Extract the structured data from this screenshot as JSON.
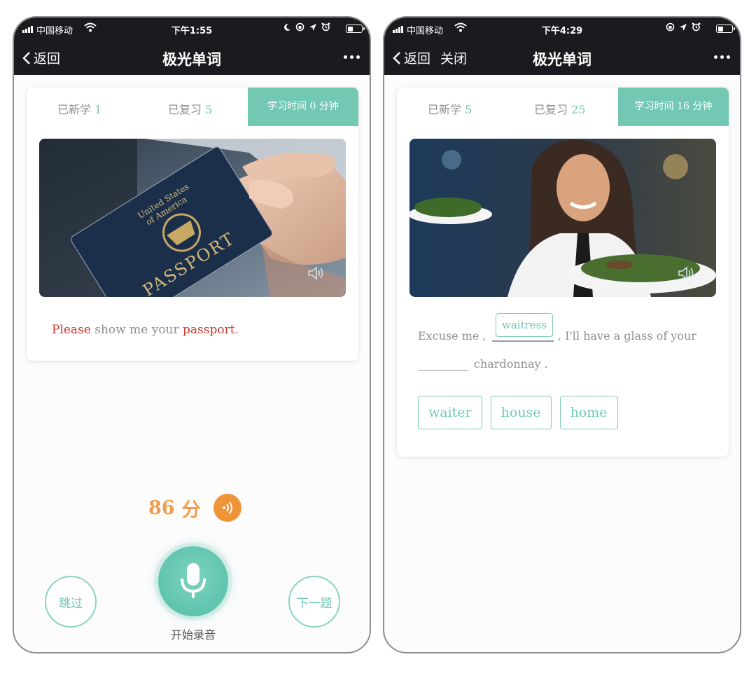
{
  "left": {
    "status": {
      "carrier": "中国移动",
      "time": "下午1:55"
    },
    "nav": {
      "back": "返回",
      "title": "极光单词"
    },
    "stats": {
      "learned_label": "已新学",
      "learned_value": "1",
      "reviewed_label": "已复习",
      "reviewed_value": "5",
      "time_label": "学习时间 0 分钟"
    },
    "photo_text": {
      "passport": "PASSPORT",
      "united_states": "United States",
      "of_america": "of America"
    },
    "sentence": {
      "w1": "Please",
      "mid": " show me your ",
      "w2": "passport",
      "end": "."
    },
    "score": {
      "value": "86",
      "unit": "分"
    },
    "buttons": {
      "skip": "跳过",
      "record": "开始录音",
      "next": "下一题"
    }
  },
  "right": {
    "status": {
      "carrier": "中国移动",
      "time": "下午4:29"
    },
    "nav": {
      "back": "返回",
      "close": "关闭",
      "title": "极光单词"
    },
    "stats": {
      "learned_label": "已新学",
      "learned_value": "5",
      "reviewed_label": "已复习",
      "reviewed_value": "25",
      "time_label": "学习时间 16 分钟"
    },
    "exercise": {
      "part1": "Excuse me ,",
      "answer": "waitress",
      "part2": ", I'll have a glass of your",
      "part3": "chardonnay ."
    },
    "options": [
      "waiter",
      "house",
      "home"
    ]
  },
  "colors": {
    "accent": "#72c8b2",
    "highlight": "#c8392b",
    "score": "#f09c4b",
    "navbar": "#1b1b1f"
  },
  "icons": [
    "signal-icon",
    "wifi-icon",
    "moon-icon",
    "lock-rotation-icon",
    "location-icon",
    "alarm-icon",
    "battery-icon",
    "back-chevron-icon",
    "more-icon",
    "speaker-icon",
    "sound-wave-icon",
    "microphone-icon"
  ]
}
